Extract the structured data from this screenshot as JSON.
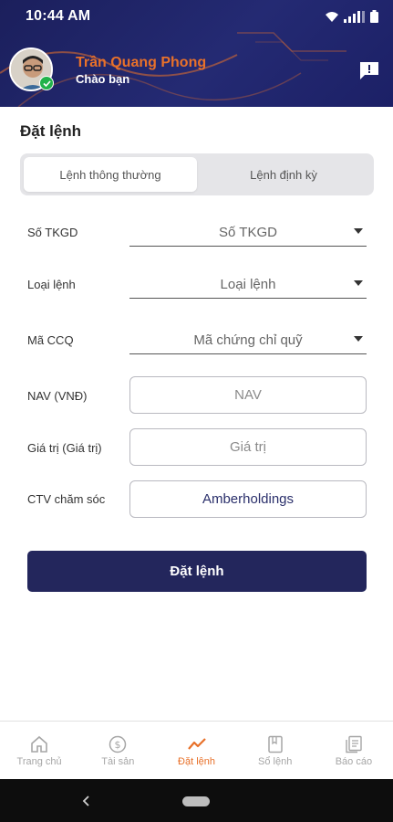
{
  "status_bar": {
    "time": "10:44 AM"
  },
  "header": {
    "user_name": "Trần Quang Phong",
    "greeting": "Chào bạn"
  },
  "page": {
    "title": "Đặt lệnh"
  },
  "segment": {
    "tabs": [
      {
        "label": "Lệnh thông thường",
        "active": true
      },
      {
        "label": "Lệnh định kỳ",
        "active": false
      }
    ]
  },
  "form": {
    "account": {
      "label": "Số TKGD",
      "value": "Số TKGD"
    },
    "order_type": {
      "label": "Loại lệnh",
      "value": "Loại lệnh"
    },
    "fund_code": {
      "label": "Mã CCQ",
      "value": "Mã chứng chỉ quỹ"
    },
    "nav": {
      "label": "NAV (VNĐ)",
      "placeholder": "NAV"
    },
    "amount": {
      "label": "Giá trị (Giá trị)",
      "placeholder": "Giá trị"
    },
    "collaborator": {
      "label": "CTV chăm sóc",
      "value": "Amberholdings"
    },
    "submit_label": "Đặt lệnh"
  },
  "tabbar": {
    "items": [
      {
        "label": "Trang chủ",
        "icon": "home-icon",
        "active": false
      },
      {
        "label": "Tài sản",
        "icon": "dollar-icon",
        "active": false
      },
      {
        "label": "Đặt lệnh",
        "icon": "chart-icon",
        "active": true
      },
      {
        "label": "Sổ lệnh",
        "icon": "book-icon",
        "active": false
      },
      {
        "label": "Báo cáo",
        "icon": "report-icon",
        "active": false
      }
    ]
  },
  "colors": {
    "header_bg": "#1b1f5c",
    "accent_orange": "#e8712a",
    "button_bg": "#23265c",
    "verified_green": "#21b24a"
  }
}
